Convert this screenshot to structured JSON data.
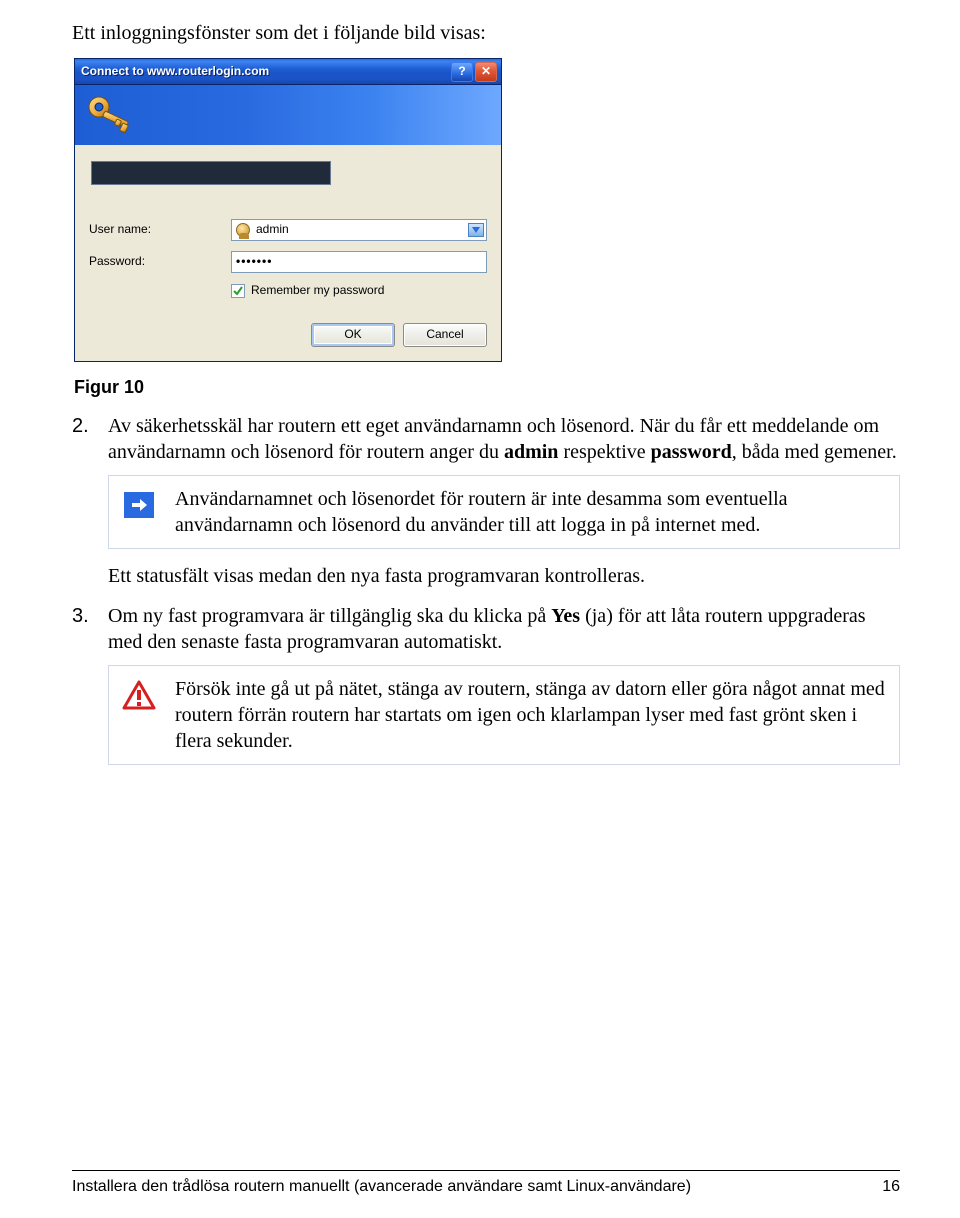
{
  "intro": "Ett inloggningsfönster som det i följande bild visas:",
  "dialog": {
    "title": "Connect to www.routerlogin.com",
    "username_label": "User name:",
    "username_value": "admin",
    "password_label": "Password:",
    "password_value": "•••••••",
    "remember_label": "Remember my password",
    "ok": "OK",
    "cancel": "Cancel"
  },
  "figure_caption": "Figur 10",
  "steps": {
    "s2": {
      "num": "2.",
      "p1_a": "Av säkerhetsskäl har routern ett eget användarnamn och lösenord. När du får ett meddelande om användarnamn och lösenord för routern anger du ",
      "p1_b": "admin",
      "p1_c": " respektive ",
      "p1_d": "password",
      "p1_e": ", båda med gemener.",
      "note": "Användarnamnet och lösenordet för routern är inte desamma som eventuella användarnamn och lösenord du använder till att logga in på internet med.",
      "p2": "Ett statusfält visas medan den nya fasta programvaran kontrolleras."
    },
    "s3": {
      "num": "3.",
      "p1_a": "Om ny fast programvara är tillgänglig ska du klicka på ",
      "p1_b": "Yes",
      "p1_c": " (ja) för att låta routern uppgraderas med den senaste fasta programvaran automatiskt.",
      "warn": "Försök inte gå ut på nätet, stänga av routern, stänga av datorn eller göra något annat med routern förrän routern har startats om igen och klarlampan lyser med fast grönt sken i flera sekunder."
    }
  },
  "footer": {
    "left": "Installera den trådlösa routern manuellt (avancerade användare samt Linux-användare)",
    "right": "16"
  }
}
